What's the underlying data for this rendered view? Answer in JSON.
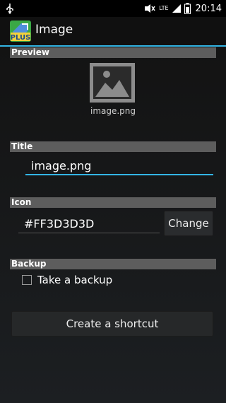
{
  "status_bar": {
    "network_label": "LTE",
    "time": "20:14"
  },
  "app": {
    "title": "Image",
    "icon_text": "PLUS"
  },
  "sections": {
    "preview": {
      "header": "Preview",
      "file_name": "image.png"
    },
    "title": {
      "header": "Title",
      "value": "image.png"
    },
    "icon": {
      "header": "Icon",
      "value": "#FF3D3D3D",
      "change_label": "Change"
    },
    "backup": {
      "header": "Backup",
      "checkbox_label": "Take a backup",
      "checked": false
    }
  },
  "create_button_label": "Create a shortcut",
  "colors": {
    "accent": "#33b5e5",
    "header_bg": "#5d5d5d",
    "button_bg": "#2a2c2e"
  }
}
